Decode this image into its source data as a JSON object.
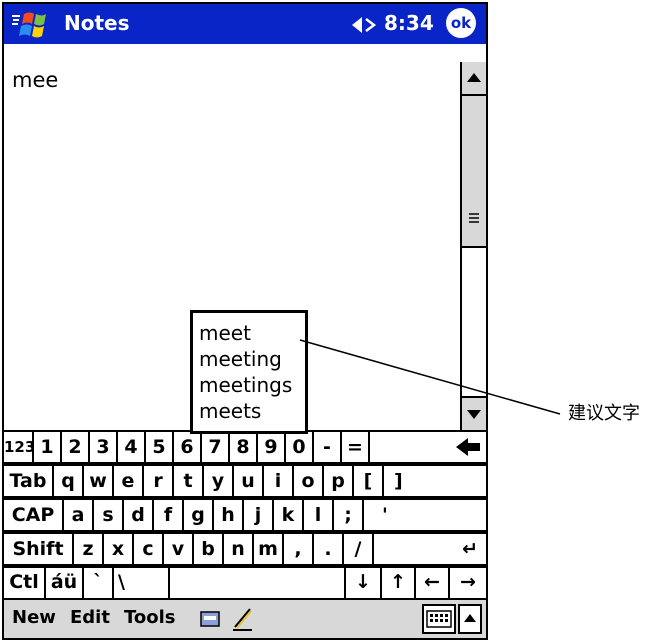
{
  "titlebar": {
    "app_title": "Notes",
    "time": "8:34",
    "ok_label": "ok",
    "start_icon": "windows-flag-icon",
    "volume_icon": "speaker-icon"
  },
  "note": {
    "text": "mee"
  },
  "suggestions": [
    "meet",
    "meeting",
    "meetings",
    "meets"
  ],
  "keyboard": {
    "rows": [
      [
        "123",
        "1",
        "2",
        "3",
        "4",
        "5",
        "6",
        "7",
        "8",
        "9",
        "0",
        "-",
        "=",
        "◆"
      ],
      [
        "Tab",
        "q",
        "w",
        "e",
        "r",
        "t",
        "y",
        "u",
        "i",
        "o",
        "p",
        "[",
        "]"
      ],
      [
        "CAP",
        "a",
        "s",
        "d",
        "f",
        "g",
        "h",
        "j",
        "k",
        "l",
        ";",
        "'"
      ],
      [
        "Shift",
        "z",
        "x",
        "c",
        "v",
        "b",
        "n",
        "m",
        ",",
        ".",
        "/",
        "↵"
      ],
      [
        "Ctl",
        "áü",
        "`",
        "\\",
        "",
        "↓",
        "↑",
        "←",
        "→"
      ]
    ]
  },
  "menubar": {
    "items": [
      "New",
      "Edit",
      "Tools"
    ],
    "icons": [
      "record-icon",
      "pen-icon",
      "keyboard-icon",
      "input-selector-arrow-icon"
    ]
  },
  "callout": {
    "label": "建议文字"
  },
  "colors": {
    "titlebar": "#0a25c7",
    "chrome": "#d8d8d8"
  }
}
